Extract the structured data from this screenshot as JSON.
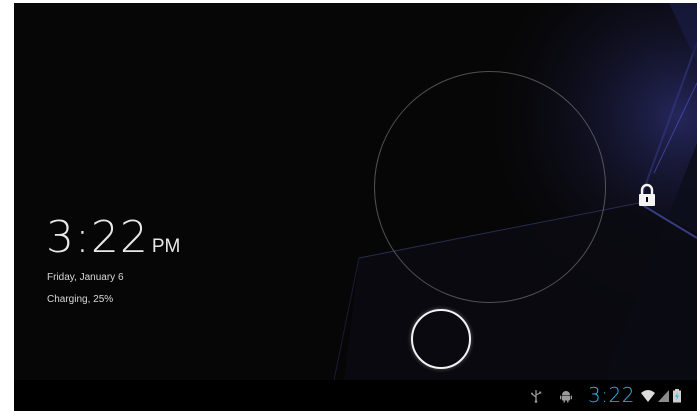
{
  "lockscreen": {
    "clock": {
      "time": "3:22",
      "ampm": "PM"
    },
    "date": "Friday, January 6",
    "charging_status": "Charging, 25%"
  },
  "system_bar": {
    "clock": "3:22",
    "accent_color": "#33b5e5",
    "icons": [
      "usb-icon",
      "android-debug-icon",
      "wifi-icon",
      "signal-icon",
      "battery-icon"
    ]
  },
  "colors": {
    "background": "#060606",
    "wallpaper_accent": "#3b3f9c",
    "text": "#e8e8e8"
  }
}
